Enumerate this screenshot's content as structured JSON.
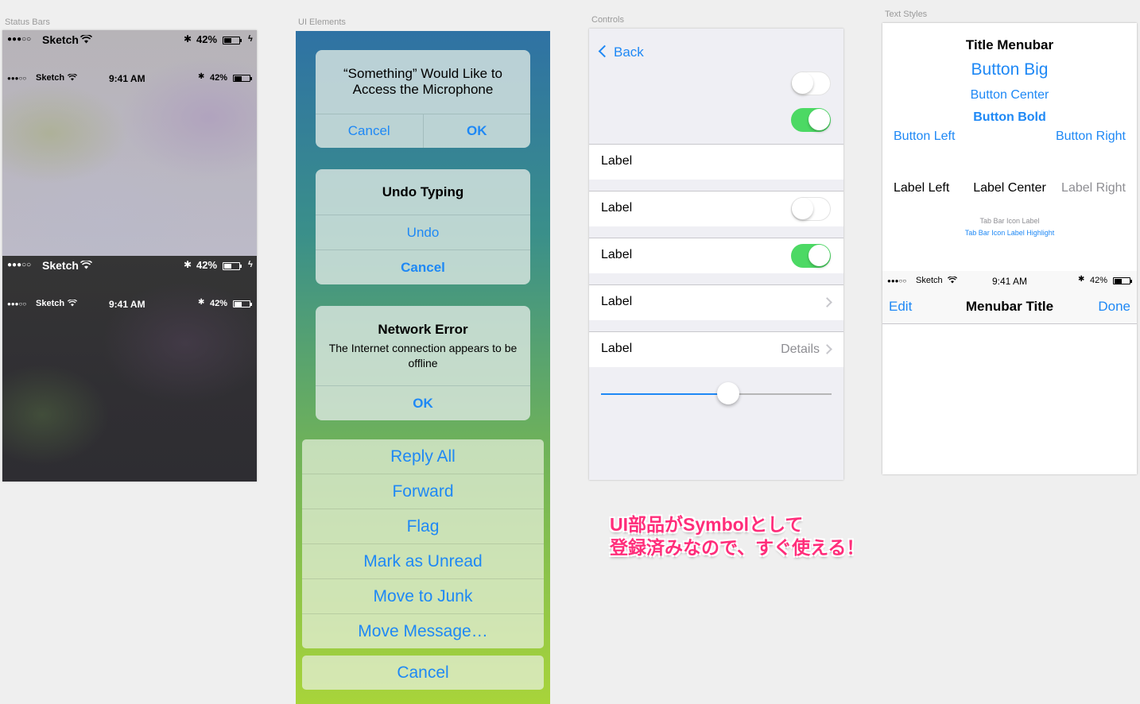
{
  "artboards": {
    "status_bars": "Status Bars",
    "ui_elements": "UI Elements",
    "controls": "Controls",
    "text_styles": "Text Styles"
  },
  "status_bars": {
    "bar_a": {
      "dots": "●●●○○",
      "carrier": "Sketch",
      "battery": "42%"
    },
    "bar_b": {
      "dots": "●●●○○",
      "carrier": "Sketch",
      "time": "9:41 AM",
      "battery": "42%"
    },
    "bar_c": {
      "dots": "●●●○○",
      "carrier": "Sketch",
      "battery": "42%"
    },
    "bar_d": {
      "dots": "●●●○○",
      "carrier": "Sketch",
      "time": "9:41 AM",
      "battery": "42%"
    }
  },
  "ui_elements": {
    "alert_mic": {
      "title": "“Something” Would Like to Access the Microphone",
      "cancel": "Cancel",
      "ok": "OK"
    },
    "alert_undo": {
      "title": "Undo Typing",
      "undo": "Undo",
      "cancel": "Cancel"
    },
    "alert_network": {
      "title": "Network Error",
      "message": "The Internet connection appears to be offline",
      "ok": "OK"
    },
    "action_sheet": {
      "items": [
        "Reply All",
        "Forward",
        "Flag",
        "Mark as Unread",
        "Move to Junk",
        "Move Message…"
      ],
      "cancel": "Cancel"
    }
  },
  "controls": {
    "back": "Back",
    "switch_1": "off",
    "switch_2": "on",
    "cells": [
      {
        "label": "Label"
      },
      {
        "label": "Label",
        "accessory": "switch-off"
      },
      {
        "label": "Label",
        "accessory": "switch-on"
      },
      {
        "label": "Label",
        "accessory": "disclosure"
      },
      {
        "label": "Label",
        "detail": "Details",
        "accessory": "disclosure"
      }
    ],
    "slider_value": 0.55
  },
  "text_styles": {
    "title_menubar": "Title Menubar",
    "button_big": "Button Big",
    "button_center": "Button Center",
    "button_bold": "Button Bold",
    "button_left": "Button Left",
    "button_right": "Button Right",
    "label_left": "Label Left",
    "label_center": "Label Center",
    "label_right": "Label Right",
    "tab_bar_icon_label": "Tab Bar Icon Label",
    "tab_bar_icon_label_highlight": "Tab Bar Icon Label Highlight",
    "status": {
      "dots": "●●●○○",
      "carrier": "Sketch",
      "time": "9:41 AM",
      "battery": "42%"
    },
    "navbar": {
      "left": "Edit",
      "title": "Menubar Title",
      "right": "Done"
    }
  },
  "annotation": {
    "line1": "UI部品がSymbolとして",
    "line2": "登録済みなので、すぐ使える！"
  },
  "colors": {
    "accent": "#1e88f5",
    "switch_on": "#4cd964",
    "annotation": "#ff2d7a"
  }
}
